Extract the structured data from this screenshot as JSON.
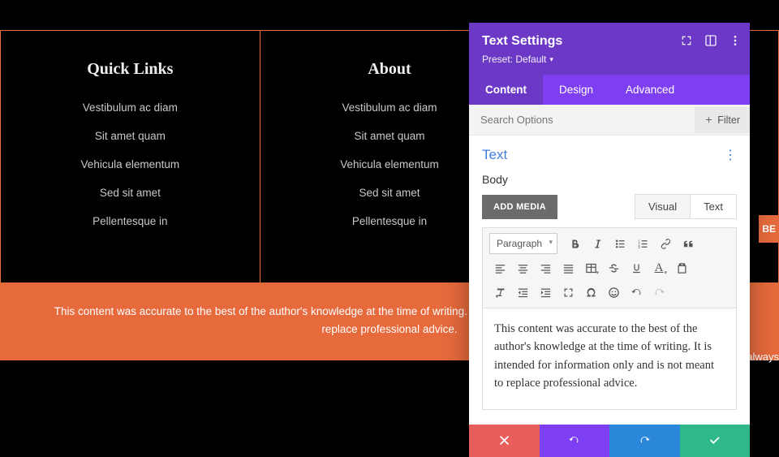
{
  "footer": {
    "columns": [
      {
        "title": "Quick Links",
        "items": [
          "Vestibulum ac diam",
          "Sit amet quam",
          "Vehicula elementum",
          "Sed sit amet",
          "Pellentesque in"
        ]
      },
      {
        "title": "About",
        "items": [
          "Vestibulum ac diam",
          "Sit amet quam",
          "Vehicula elementum",
          "Sed sit amet",
          "Pellentesque in"
        ]
      },
      {
        "title": "",
        "items": []
      }
    ],
    "disclaimer": "This content was accurate to the best of the author's knowledge at the time of writing. It is intended for information only and is not meant to replace professional advice."
  },
  "stubs": {
    "subscribe": "BE",
    "always": "always"
  },
  "modal": {
    "title": "Text Settings",
    "preset_label": "Preset: Default",
    "tabs": {
      "content": "Content",
      "design": "Design",
      "advanced": "Advanced"
    },
    "search_placeholder": "Search Options",
    "filter_label": "Filter",
    "section_title": "Text",
    "body_label": "Body",
    "add_media": "ADD MEDIA",
    "vt": {
      "visual": "Visual",
      "text": "Text"
    },
    "paragraph_label": "Paragraph",
    "editor_value": "This content was accurate to the best of the author's knowledge at the time of writing. It is intended for information only and is not meant to replace professional advice."
  }
}
